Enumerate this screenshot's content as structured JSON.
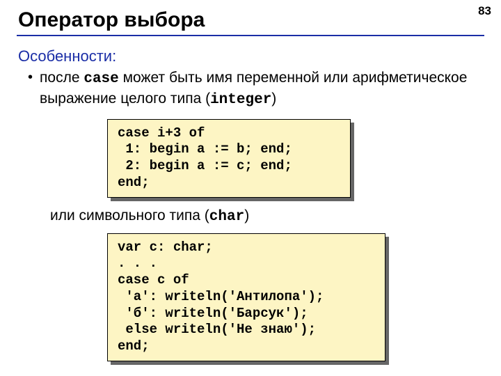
{
  "page_number": "83",
  "title": "Оператор выбора",
  "subtitle": "Особенности:",
  "bullet": {
    "pre": "после ",
    "kw1": "case",
    "mid1": " может быть имя переменной или арифметическое выражение целого типа (",
    "kw2": "integer",
    "post1": ")"
  },
  "code1": "case i+3 of\n 1: begin a := b; end;\n 2: begin a := c; end;\nend;",
  "follow": {
    "pre": "или символьного типа (",
    "kw": "char",
    "post": ")"
  },
  "code2": "var c: char;\n. . .\ncase c of\n 'а': writeln('Антилопа');\n 'б': writeln('Барсук');\n else writeln('Не знаю');\nend;"
}
